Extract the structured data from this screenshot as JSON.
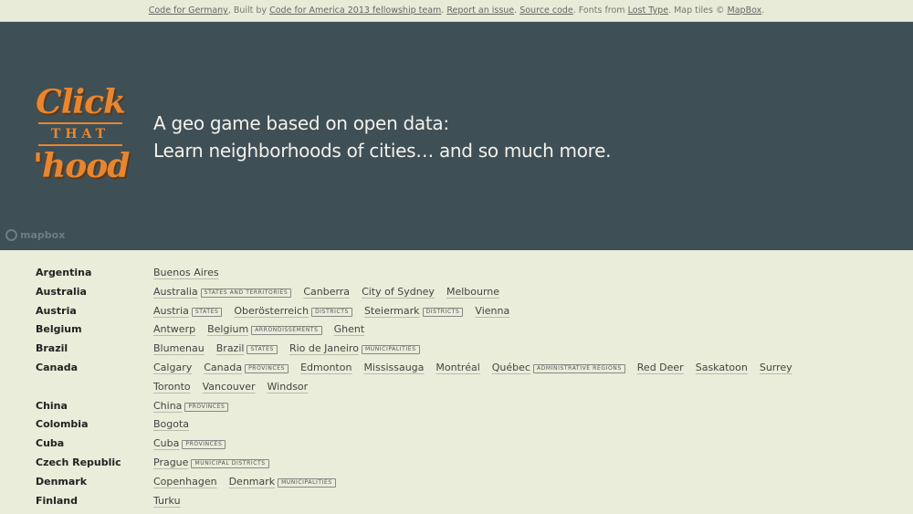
{
  "topbar": {
    "link_cfg": "Code for Germany",
    "text_built": ", Built by",
    "link_cfa": "Code for America 2013 fellowship team",
    "text_dot1": ".",
    "link_issue": "Report an issue",
    "text_dot2": ".",
    "link_source": "Source code",
    "text_fonts": ". Fonts from",
    "link_lost": "Lost Type",
    "text_tiles": ". Map tiles ©",
    "link_mapbox": "MapBox",
    "text_end": "."
  },
  "logo": {
    "word1": "Click",
    "word2": "THAT",
    "word3": "'hood"
  },
  "tagline": {
    "line1": "A geo game based on open data:",
    "line2": "Learn neighborhoods of cities… and so much more."
  },
  "mapbox_attrib": "mapbox",
  "countries": [
    {
      "name": "Argentina",
      "cities": [
        {
          "name": "Buenos Aires"
        }
      ]
    },
    {
      "name": "Australia",
      "cities": [
        {
          "name": "Australia",
          "tag": "STATES AND TERRITORIES"
        },
        {
          "name": "Canberra"
        },
        {
          "name": "City of Sydney"
        },
        {
          "name": "Melbourne"
        }
      ]
    },
    {
      "name": "Austria",
      "cities": [
        {
          "name": "Austria",
          "tag": "STATES"
        },
        {
          "name": "Oberösterreich",
          "tag": "DISTRICTS"
        },
        {
          "name": "Steiermark",
          "tag": "DISTRICTS"
        },
        {
          "name": "Vienna"
        }
      ]
    },
    {
      "name": "Belgium",
      "cities": [
        {
          "name": "Antwerp"
        },
        {
          "name": "Belgium",
          "tag": "ARRONDISSEMENTS"
        },
        {
          "name": "Ghent"
        }
      ]
    },
    {
      "name": "Brazil",
      "cities": [
        {
          "name": "Blumenau"
        },
        {
          "name": "Brazil",
          "tag": "STATES"
        },
        {
          "name": "Rio de Janeiro",
          "tag": "MUNICIPALITIES"
        }
      ]
    },
    {
      "name": "Canada",
      "cities": [
        {
          "name": "Calgary"
        },
        {
          "name": "Canada",
          "tag": "PROVINCES"
        },
        {
          "name": "Edmonton"
        },
        {
          "name": "Mississauga"
        },
        {
          "name": "Montréal"
        },
        {
          "name": "Québec",
          "tag": "ADMINISTRATIVE REGIONS"
        },
        {
          "name": "Red Deer"
        },
        {
          "name": "Saskatoon"
        },
        {
          "name": "Surrey"
        },
        {
          "name": "Toronto"
        },
        {
          "name": "Vancouver"
        },
        {
          "name": "Windsor"
        }
      ]
    },
    {
      "name": "China",
      "cities": [
        {
          "name": "China",
          "tag": "PROVINCES"
        }
      ]
    },
    {
      "name": "Colombia",
      "cities": [
        {
          "name": "Bogota"
        }
      ]
    },
    {
      "name": "Cuba",
      "cities": [
        {
          "name": "Cuba",
          "tag": "PROVINCES"
        }
      ]
    },
    {
      "name": "Czech Republic",
      "cities": [
        {
          "name": "Prague",
          "tag": "MUNICIPAL DISTRICTS"
        }
      ]
    },
    {
      "name": "Denmark",
      "cities": [
        {
          "name": "Copenhagen"
        },
        {
          "name": "Denmark",
          "tag": "MUNICIPALITIES"
        }
      ]
    },
    {
      "name": "Finland",
      "cities": [
        {
          "name": "Turku"
        }
      ]
    }
  ]
}
